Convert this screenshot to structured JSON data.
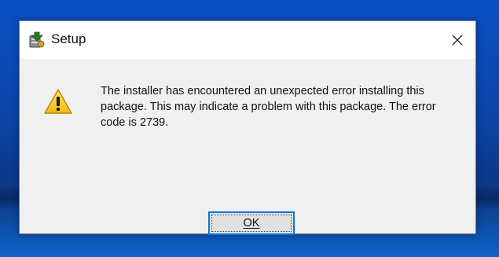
{
  "dialog": {
    "title": "Setup",
    "message": "The installer has encountered an unexpected error installing this package. This may indicate a problem with this package. The error code is 2739.",
    "ok_label": "OK"
  },
  "icons": {
    "app": "setup-installer-icon",
    "close": "close-icon",
    "warning": "warning-icon"
  },
  "colors": {
    "desktop": "#0b45a8",
    "accent": "#0078d7",
    "dialog_bg": "#f0f0f0",
    "warning_yellow": "#f6c41a"
  }
}
